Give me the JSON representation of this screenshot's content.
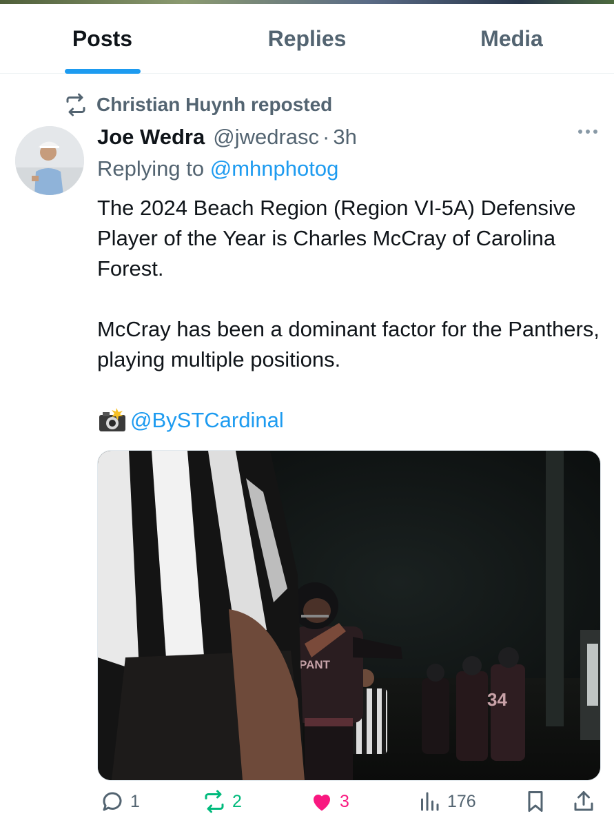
{
  "tabs": [
    {
      "label": "Posts",
      "active": true
    },
    {
      "label": "Replies",
      "active": false
    },
    {
      "label": "Media",
      "active": false
    }
  ],
  "post": {
    "repost_text": "Christian Huynh reposted",
    "author_name": "Joe Wedra",
    "author_handle": "@jwedrasc",
    "time": "3h",
    "replying_prefix": "Replying to",
    "replying_handle": "@mhnphotog",
    "body_para1": "The 2024 Beach Region (Region VI-5A) Defensive Player of the Year is Charles McCray of Carolina Forest.",
    "body_para2": "McCray has been a dominant factor for the Panthers, playing multiple positions.",
    "photo_credit": "@BySTCardinal",
    "jersey_text": "PANT",
    "actions": {
      "replies": "1",
      "reposts": "2",
      "likes": "3",
      "views": "176"
    }
  },
  "colors": {
    "accent": "#1d9bf0",
    "repost_green": "#00ba7c",
    "like_pink": "#f91880",
    "muted": "#536471"
  },
  "icons": [
    "repost-icon",
    "more-icon",
    "camera-flash-icon",
    "reply-icon",
    "repost-icon",
    "heart-icon",
    "views-icon",
    "bookmark-icon",
    "share-icon"
  ]
}
